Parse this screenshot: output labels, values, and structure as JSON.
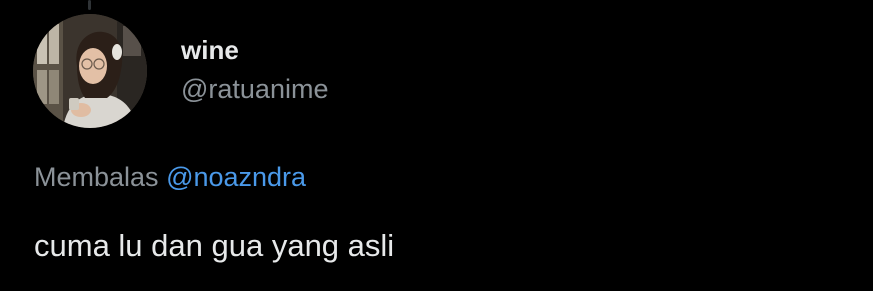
{
  "tweet": {
    "author": {
      "display_name": "wine",
      "handle": "@ratuanime",
      "avatar_icon": "profile-photo"
    },
    "reply": {
      "label": "Membalas",
      "mention": "@noazndra"
    },
    "text": "cuma lu dan gua yang asli"
  },
  "colors": {
    "background": "#000000",
    "primary_text": "#e7e9ea",
    "secondary_text": "#8b9298",
    "link": "#4a99e9"
  }
}
